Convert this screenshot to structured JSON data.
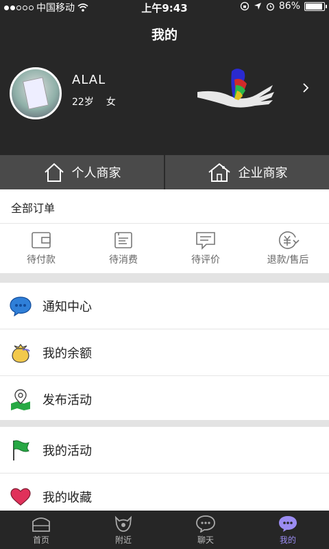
{
  "status_bar": {
    "carrier": "中国移动",
    "time": "上午9:43",
    "battery": "86%",
    "battery_level": 0.86
  },
  "header": {
    "title": "我的"
  },
  "profile": {
    "name": "ALAL",
    "age": "22岁",
    "gender": "女"
  },
  "merchant": {
    "personal": "个人商家",
    "enterprise": "企业商家"
  },
  "orders": {
    "title": "全部订单",
    "items": [
      {
        "label": "待付款",
        "icon": "wallet-icon"
      },
      {
        "label": "待消费",
        "icon": "ticket-icon"
      },
      {
        "label": "待评价",
        "icon": "comment-icon"
      },
      {
        "label": "退款/售后",
        "icon": "refund-icon"
      }
    ]
  },
  "menu": {
    "group1": [
      {
        "label": "通知中心",
        "icon": "chat-bubble-icon",
        "color": "#2f7fd8"
      },
      {
        "label": "我的余额",
        "icon": "money-bag-icon",
        "color": "#f2c94c"
      },
      {
        "label": "发布活动",
        "icon": "map-pin-icon",
        "color": "#27a844"
      }
    ],
    "group2": [
      {
        "label": "我的活动",
        "icon": "flag-icon",
        "color": "#27a844"
      },
      {
        "label": "我的收藏",
        "icon": "heart-icon",
        "color": "#e0315a"
      }
    ]
  },
  "tabbar": {
    "items": [
      {
        "label": "首页",
        "active": false
      },
      {
        "label": "附近",
        "active": false
      },
      {
        "label": "聊天",
        "active": false
      },
      {
        "label": "我的",
        "active": true
      }
    ],
    "active_color": "#9b8cf2"
  }
}
